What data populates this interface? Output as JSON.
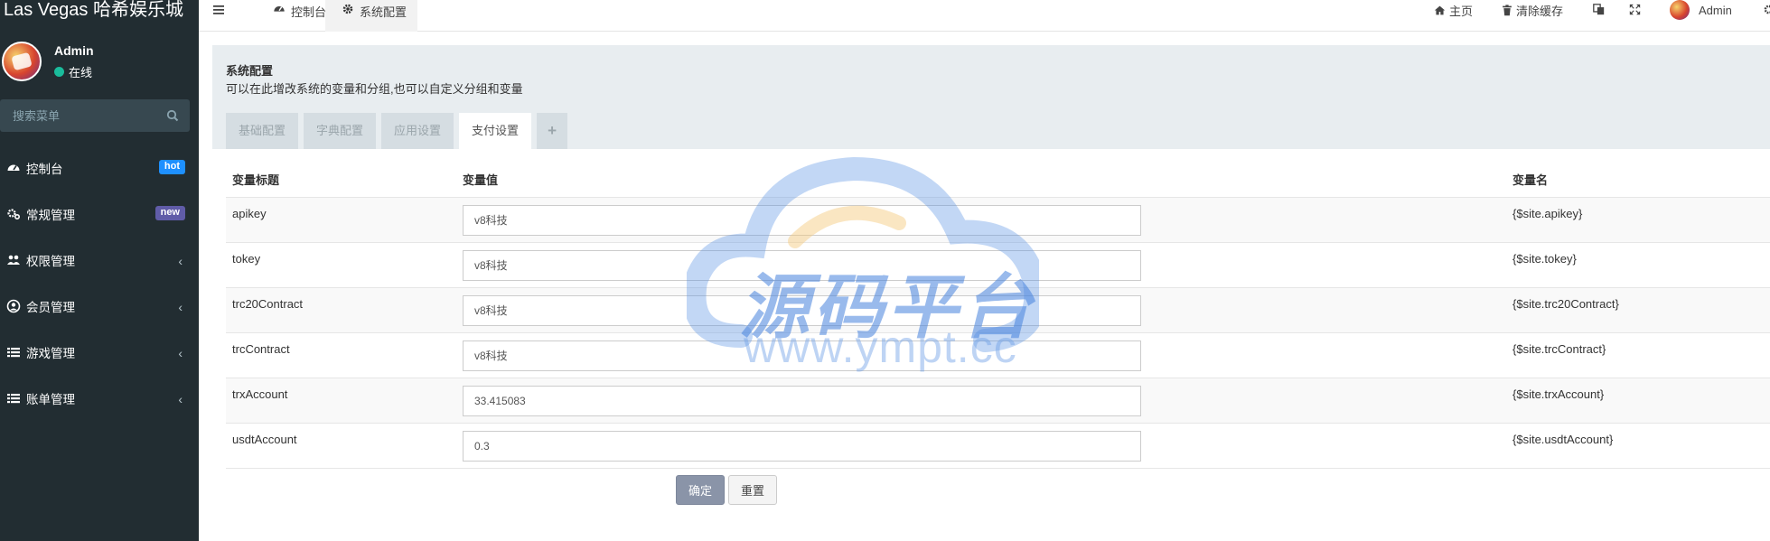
{
  "brand": {
    "title": "Las Vegas 哈希娱乐城"
  },
  "user": {
    "name": "Admin",
    "status": "在线"
  },
  "search": {
    "placeholder": "搜索菜单"
  },
  "menu": [
    {
      "label": "控制台",
      "icon": "dashboard-icon",
      "badge": "hot",
      "badge_color": "#1e90ff"
    },
    {
      "label": "常规管理",
      "icon": "cogs-icon",
      "badge": "new",
      "badge_color": "#605ca8"
    },
    {
      "label": "权限管理",
      "icon": "group-icon",
      "chevron": "‹"
    },
    {
      "label": "会员管理",
      "icon": "user-circle-icon",
      "chevron": "‹"
    },
    {
      "label": "游戏管理",
      "icon": "list-icon",
      "chevron": "‹"
    },
    {
      "label": "账单管理",
      "icon": "list-icon",
      "chevron": "‹"
    }
  ],
  "topbar": {
    "tabs": [
      {
        "label": "控制台",
        "icon": "dashboard-icon"
      },
      {
        "label": "系统配置",
        "icon": "gear-icon",
        "active": true
      }
    ],
    "right": {
      "home": "主页",
      "clear_cache": "清除缓存",
      "user": "Admin"
    }
  },
  "panel": {
    "title": "系统配置",
    "description": "可以在此增改系统的变量和分组,也可以自定义分组和变量",
    "tabs": [
      "基础配置",
      "字典配置",
      "应用设置",
      "支付设置"
    ],
    "active_tab": "支付设置",
    "add_tab": "+"
  },
  "table": {
    "headers": {
      "title": "变量标题",
      "value": "变量值",
      "name": "变量名"
    },
    "rows": [
      {
        "title": "apikey",
        "value": "v8科技",
        "name": "{$site.apikey}"
      },
      {
        "title": "tokey",
        "value": "v8科技",
        "name": "{$site.tokey}"
      },
      {
        "title": "trc20Contract",
        "value": "v8科技",
        "name": "{$site.trc20Contract}"
      },
      {
        "title": "trcContract",
        "value": "v8科技",
        "name": "{$site.trcContract}"
      },
      {
        "title": "trxAccount",
        "value": "33.415083",
        "name": "{$site.trxAccount}"
      },
      {
        "title": "usdtAccount",
        "value": "0.3",
        "name": "{$site.usdtAccount}"
      }
    ]
  },
  "buttons": {
    "confirm": "确定",
    "reset": "重置"
  },
  "watermark": {
    "text": "源码平台",
    "url": "www.ympt.cc"
  },
  "colors": {
    "sidebar": "#222d32",
    "accent_blue": "#1e90ff",
    "badge_new": "#605ca8",
    "panel_bg": "#e8edf0"
  }
}
